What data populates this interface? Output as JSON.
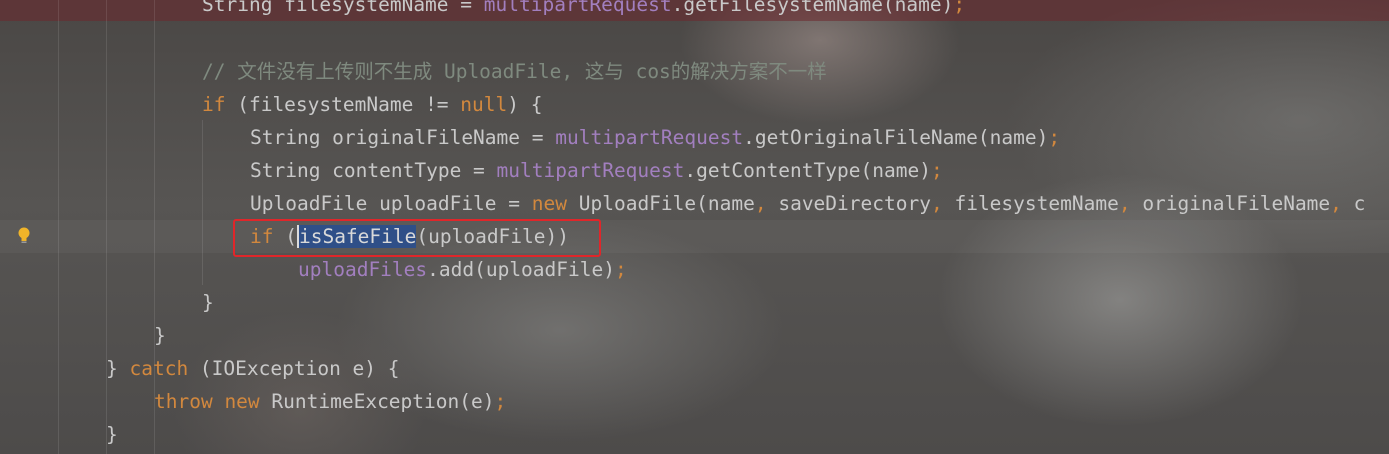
{
  "editor": {
    "lines": [
      {
        "id": "l1",
        "parts": [
          [
            "pl",
            "String filesystemName = "
          ],
          [
            "fld",
            "multipartRequest"
          ],
          [
            "pl",
            ".getFilesystemName(name)"
          ],
          [
            "kw",
            ";"
          ]
        ]
      },
      {
        "id": "l2",
        "parts": []
      },
      {
        "id": "l3",
        "parts": [
          [
            "cm",
            "// 文件没有上传则不生成 UploadFile, 这与 cos的解决方案不一样"
          ]
        ]
      },
      {
        "id": "l4",
        "parts": [
          [
            "kw",
            "if"
          ],
          [
            "pl",
            " (filesystemName != "
          ],
          [
            "kw",
            "null"
          ],
          [
            "pl",
            ") {"
          ]
        ]
      },
      {
        "id": "l5",
        "parts": [
          [
            "pl",
            "String originalFileName = "
          ],
          [
            "fld",
            "multipartRequest"
          ],
          [
            "pl",
            ".getOriginalFileName(name)"
          ],
          [
            "kw",
            ";"
          ]
        ]
      },
      {
        "id": "l6",
        "parts": [
          [
            "pl",
            "String contentType = "
          ],
          [
            "fld",
            "multipartRequest"
          ],
          [
            "pl",
            ".getContentType(name)"
          ],
          [
            "kw",
            ";"
          ]
        ]
      },
      {
        "id": "l7",
        "parts": [
          [
            "pl",
            "UploadFile uploadFile = "
          ],
          [
            "kw",
            "new"
          ],
          [
            "pl",
            " UploadFile(name"
          ],
          [
            "kw",
            ","
          ],
          [
            "pl",
            " saveDirectory"
          ],
          [
            "kw",
            ","
          ],
          [
            "pl",
            " filesystemName"
          ],
          [
            "kw",
            ","
          ],
          [
            "pl",
            " originalFileName"
          ],
          [
            "kw",
            ","
          ],
          [
            "pl",
            " c"
          ]
        ]
      },
      {
        "id": "l8",
        "parts": [
          [
            "kw",
            "if"
          ],
          [
            "pl",
            " ("
          ],
          [
            "sel",
            "isSafeFile"
          ],
          [
            "pl",
            "(uploadFile))"
          ]
        ]
      },
      {
        "id": "l9",
        "parts": [
          [
            "fld",
            "uploadFiles"
          ],
          [
            "pl",
            ".add(uploadFile)"
          ],
          [
            "kw",
            ";"
          ]
        ]
      },
      {
        "id": "l10",
        "parts": [
          [
            "pl",
            "}"
          ]
        ]
      },
      {
        "id": "l11",
        "parts": [
          [
            "pl",
            "}"
          ]
        ]
      },
      {
        "id": "l12",
        "parts": [
          [
            "pl",
            "} "
          ],
          [
            "kw",
            "catch"
          ],
          [
            "pl",
            " (IOException e) {"
          ]
        ]
      },
      {
        "id": "l13",
        "parts": [
          [
            "kw",
            "throw new"
          ],
          [
            "pl",
            " RuntimeException(e)"
          ],
          [
            "kw",
            ";"
          ]
        ]
      },
      {
        "id": "l14",
        "parts": [
          [
            "pl",
            "}"
          ]
        ]
      }
    ]
  },
  "colors": {
    "keyword": "#d2883e",
    "field": "#a27fbf",
    "comment": "#7f8a7f",
    "plain": "#c9c9c9",
    "selection": "#2f4f88",
    "annotation_box": "#e0262a",
    "error_line_highlight": "#5a2f33"
  },
  "icons": {
    "gutter_intention": "lightbulb-icon"
  }
}
